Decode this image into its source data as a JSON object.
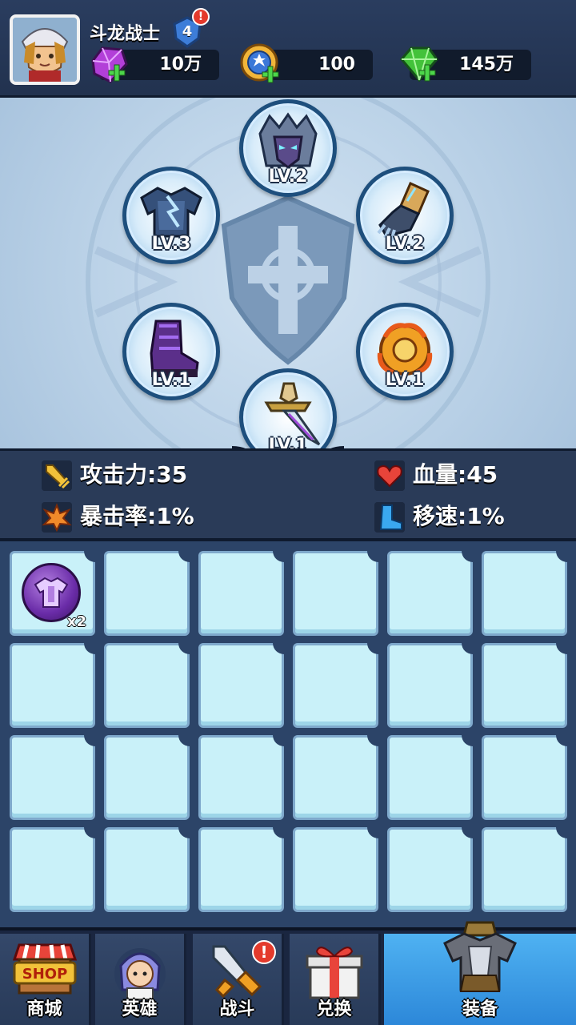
{
  "player": {
    "name": "斗龙战士",
    "level": "4",
    "level_alert": "!"
  },
  "resources": [
    {
      "icon": "purple-gem-icon",
      "value": "10万"
    },
    {
      "icon": "star-coin-icon",
      "value": "100"
    },
    {
      "icon": "green-gem-icon",
      "value": "145万"
    }
  ],
  "equipment_slots": [
    {
      "slot": "helmet",
      "icon": "helmet-icon",
      "level": "LV.2"
    },
    {
      "slot": "armor",
      "icon": "armor-icon",
      "level": "LV.3"
    },
    {
      "slot": "gauntlet",
      "icon": "gauntlet-icon",
      "level": "LV.2"
    },
    {
      "slot": "boots",
      "icon": "boots-icon",
      "level": "LV.1"
    },
    {
      "slot": "amulet",
      "icon": "amulet-icon",
      "level": "LV.1"
    },
    {
      "slot": "weapon",
      "icon": "sword-icon",
      "level": "LV.1"
    }
  ],
  "stats": {
    "attack": "攻击力:35",
    "hp": "血量:45",
    "crit": "暴击率:1%",
    "speed": "移速:1%"
  },
  "inventory": {
    "items": [
      {
        "icon": "purple-armor-orb-icon",
        "count": "x2"
      }
    ]
  },
  "nav": {
    "shop": {
      "label": "商城",
      "badge": "SHOP"
    },
    "heroes": {
      "label": "英雄"
    },
    "battle": {
      "label": "战斗",
      "alert": "!"
    },
    "exchange": {
      "label": "兑换"
    },
    "equipment": {
      "label": "装备"
    }
  }
}
